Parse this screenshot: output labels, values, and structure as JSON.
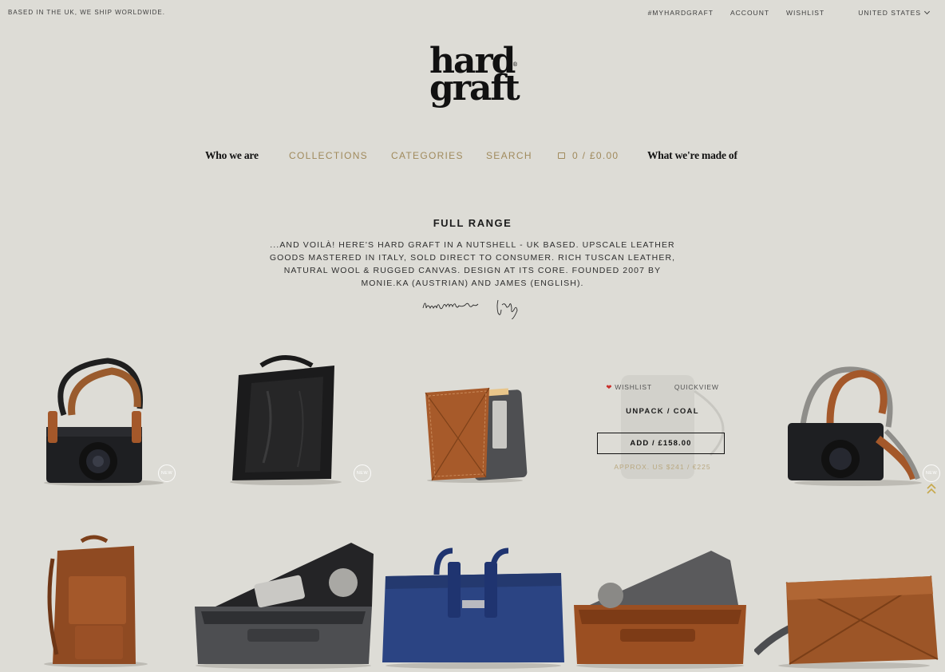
{
  "topbar": {
    "tagline": "BASED IN THE UK, WE SHIP WORLDWIDE.",
    "links": [
      "#MYHARDGRAFT",
      "ACCOUNT",
      "WISHLIST"
    ],
    "country": "UNITED STATES"
  },
  "logo": {
    "line1": "hard",
    "line2": "graft",
    "mark": "®"
  },
  "nav": {
    "who": "Who we are",
    "collections": "COLLECTIONS",
    "categories": "CATEGORIES",
    "search": "SEARCH",
    "cart": "0 / £0.00",
    "made": "What we're made of"
  },
  "intro": {
    "title": "FULL RANGE",
    "text": "...AND VOILÀ! HERE'S HARD GRAFT IN A NUTSHELL - UK BASED. UPSCALE LEATHER GOODS MASTERED IN ITALY, SOLD DIRECT TO CONSUMER. RICH TUSCAN LEATHER, NATURAL WOOL & RUGGED CANVAS. DESIGN AT ITS CORE. FOUNDED 2007 BY MONIE.KA (AUSTRIAN) AND JAMES (ENGLISH).",
    "script": "handmade in Italy"
  },
  "badge_text": "NEW",
  "hover": {
    "wishlist": "WISHLIST",
    "quickview": "QUICKVIEW",
    "name": "UNPACK / COAL",
    "add": "ADD / £158.00",
    "approx": "APPROX. US $241 / €225"
  },
  "colors": {
    "background": "#dddcd6",
    "accent": "#a08a5c",
    "tan_leather": "#a4582a",
    "navy": "#2b4483",
    "felt": "#5a5a5c"
  }
}
